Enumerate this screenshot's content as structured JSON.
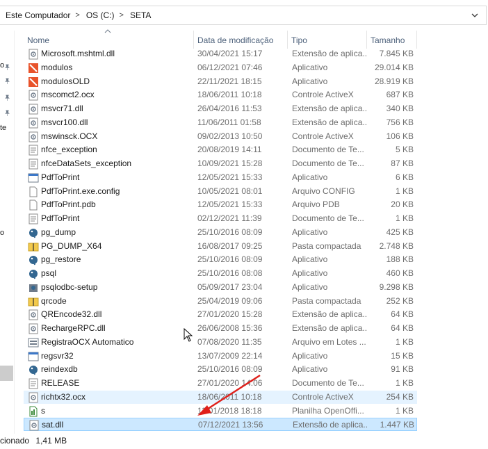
{
  "address": {
    "crumbs": [
      "Este Computador",
      "OS (C:)",
      "SETA"
    ],
    "separator": ">"
  },
  "nav": {
    "snippets": [
      "o",
      "te",
      "o"
    ]
  },
  "columns": {
    "name": "Nome",
    "date": "Data de modificação",
    "type": "Tipo",
    "size": "Tamanho"
  },
  "files": [
    {
      "name": "Microsoft.mshtml.dll",
      "date": "30/04/2021 15:17",
      "type": "Extensão de aplica...",
      "size": "7.845 KB",
      "icon": "dll-icon"
    },
    {
      "name": "modulos",
      "date": "06/12/2021 07:46",
      "type": "Aplicativo",
      "size": "29.014 KB",
      "icon": "app-red-icon"
    },
    {
      "name": "modulosOLD",
      "date": "22/11/2021 18:15",
      "type": "Aplicativo",
      "size": "28.919 KB",
      "icon": "app-red-icon"
    },
    {
      "name": "mscomct2.ocx",
      "date": "18/06/2011 10:18",
      "type": "Controle ActiveX",
      "size": "687 KB",
      "icon": "dll-icon"
    },
    {
      "name": "msvcr71.dll",
      "date": "26/04/2016 11:53",
      "type": "Extensão de aplica...",
      "size": "340 KB",
      "icon": "dll-icon"
    },
    {
      "name": "msvcr100.dll",
      "date": "11/06/2011 01:58",
      "type": "Extensão de aplica...",
      "size": "756 KB",
      "icon": "dll-icon"
    },
    {
      "name": "mswinsck.OCX",
      "date": "09/02/2013 10:50",
      "type": "Controle ActiveX",
      "size": "106 KB",
      "icon": "dll-icon"
    },
    {
      "name": "nfce_exception",
      "date": "20/08/2019 14:11",
      "type": "Documento de Te...",
      "size": "5 KB",
      "icon": "text-doc-icon"
    },
    {
      "name": "nfceDataSets_exception",
      "date": "10/09/2021 15:28",
      "type": "Documento de Te...",
      "size": "87 KB",
      "icon": "text-doc-icon"
    },
    {
      "name": "PdfToPrint",
      "date": "12/05/2021 15:33",
      "type": "Aplicativo",
      "size": "6 KB",
      "icon": "app-window-icon"
    },
    {
      "name": "PdfToPrint.exe.config",
      "date": "10/05/2021 08:01",
      "type": "Arquivo CONFIG",
      "size": "1 KB",
      "icon": "blank-file-icon"
    },
    {
      "name": "PdfToPrint.pdb",
      "date": "12/05/2021 15:33",
      "type": "Arquivo PDB",
      "size": "20 KB",
      "icon": "blank-file-icon"
    },
    {
      "name": "PdfToPrint",
      "date": "02/12/2021 11:39",
      "type": "Documento de Te...",
      "size": "1 KB",
      "icon": "text-doc-icon"
    },
    {
      "name": "pg_dump",
      "date": "25/10/2016 08:09",
      "type": "Aplicativo",
      "size": "425 KB",
      "icon": "elephant-icon"
    },
    {
      "name": "PG_DUMP_X64",
      "date": "16/08/2017 09:25",
      "type": "Pasta compactada",
      "size": "2.748 KB",
      "icon": "zip-folder-icon"
    },
    {
      "name": "pg_restore",
      "date": "25/10/2016 08:09",
      "type": "Aplicativo",
      "size": "188 KB",
      "icon": "elephant-icon"
    },
    {
      "name": "psql",
      "date": "25/10/2016 08:08",
      "type": "Aplicativo",
      "size": "460 KB",
      "icon": "elephant-icon"
    },
    {
      "name": "psqlodbc-setup",
      "date": "05/09/2017 23:04",
      "type": "Aplicativo",
      "size": "9.298 KB",
      "icon": "installer-icon"
    },
    {
      "name": "qrcode",
      "date": "25/04/2019 09:06",
      "type": "Pasta compactada",
      "size": "252 KB",
      "icon": "zip-folder-icon"
    },
    {
      "name": "QREncode32.dll",
      "date": "27/01/2020 15:28",
      "type": "Extensão de aplica...",
      "size": "64 KB",
      "icon": "dll-icon"
    },
    {
      "name": "RechargeRPC.dll",
      "date": "26/06/2008 15:36",
      "type": "Extensão de aplica...",
      "size": "64 KB",
      "icon": "dll-icon"
    },
    {
      "name": "RegistraOCX Automatico",
      "date": "07/08/2020 11:35",
      "type": "Arquivo em Lotes ...",
      "size": "1 KB",
      "icon": "batch-icon"
    },
    {
      "name": "regsvr32",
      "date": "13/07/2009 22:14",
      "type": "Aplicativo",
      "size": "15 KB",
      "icon": "app-window-icon"
    },
    {
      "name": "reindexdb",
      "date": "25/10/2016 08:09",
      "type": "Aplicativo",
      "size": "91 KB",
      "icon": "elephant-icon"
    },
    {
      "name": "RELEASE",
      "date": "27/01/2020 14:06",
      "type": "Documento de Te...",
      "size": "1 KB",
      "icon": "text-doc-icon"
    },
    {
      "name": "richtx32.ocx",
      "date": "18/06/2011 10:18",
      "type": "Controle ActiveX",
      "size": "254 KB",
      "icon": "dll-icon",
      "state": "hover"
    },
    {
      "name": "s",
      "date": "11/01/2018 18:18",
      "type": "Planilha OpenOffi...",
      "size": "1 KB",
      "icon": "spreadsheet-icon"
    },
    {
      "name": "sat.dll",
      "date": "07/12/2021 13:56",
      "type": "Extensão de aplica...",
      "size": "1.447 KB",
      "icon": "dll-icon",
      "state": "selected"
    }
  ],
  "status": {
    "selected_text": "cionado",
    "selected_size": "1,41 MB"
  },
  "colors": {
    "annotation_arrow": "#e0201b",
    "selection": "#cce8ff",
    "hover": "#e5f3ff"
  }
}
